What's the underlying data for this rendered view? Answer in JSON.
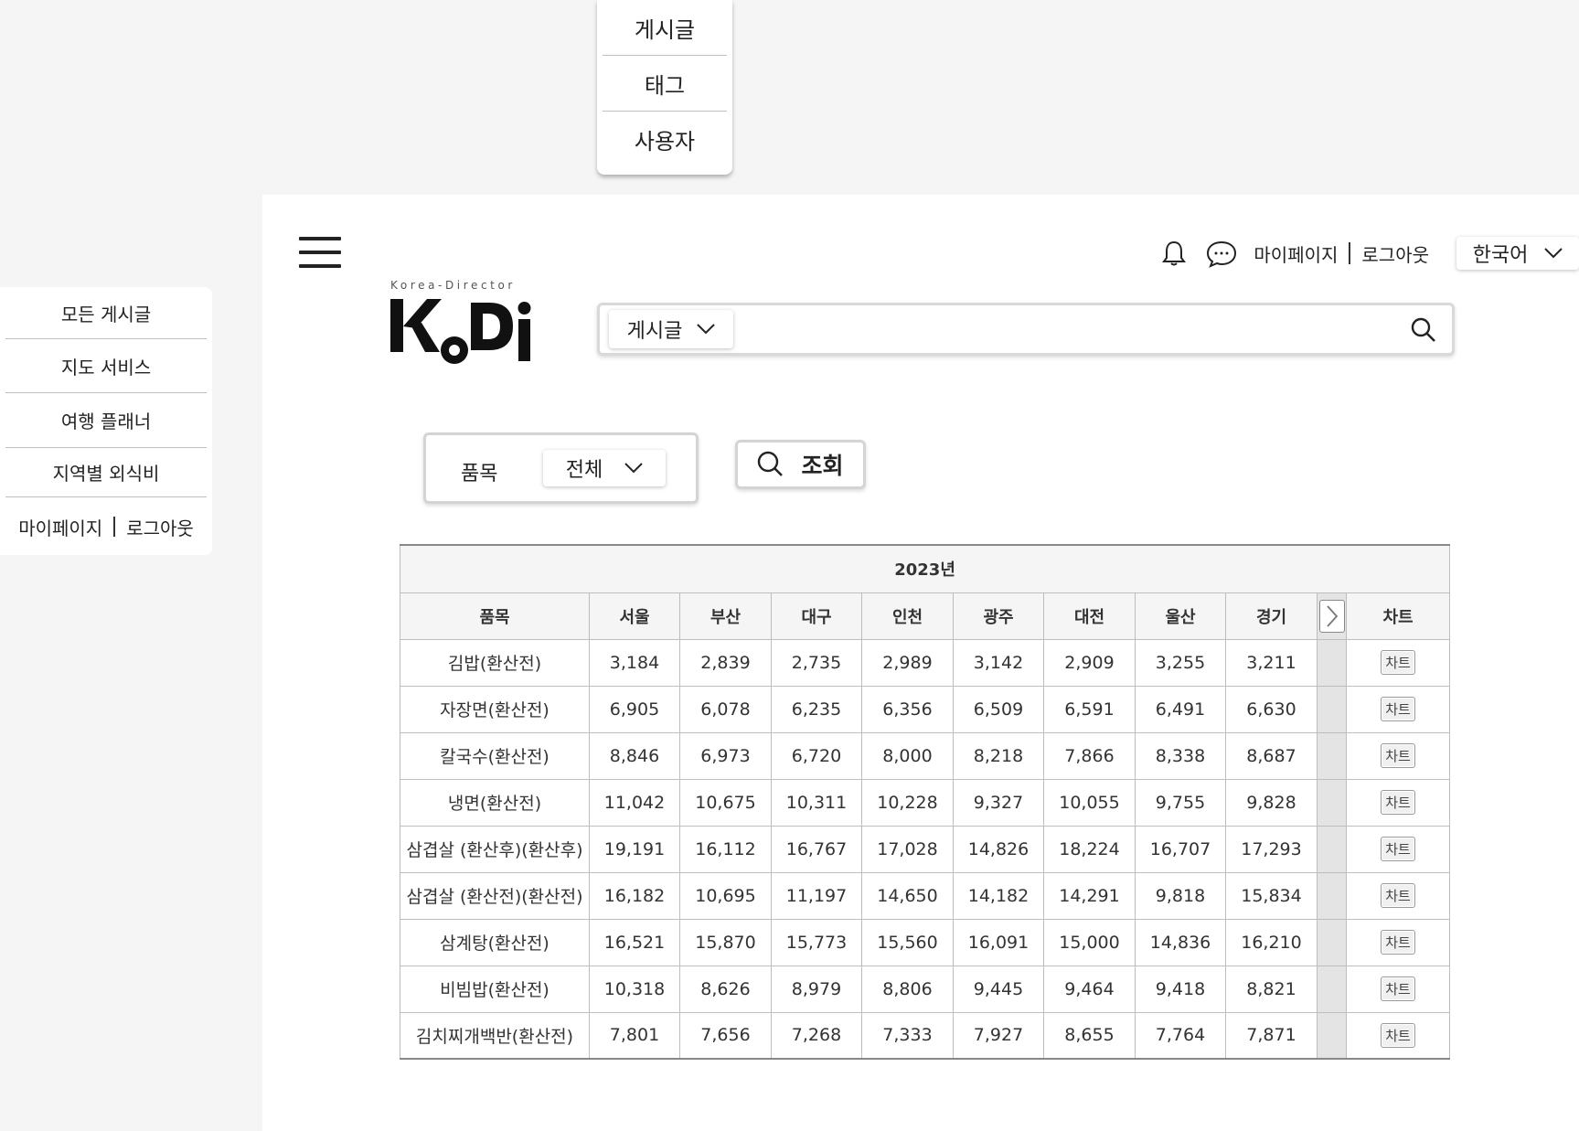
{
  "category_dropdown": {
    "options": [
      "게시글",
      "태그",
      "사용자"
    ]
  },
  "header": {
    "logo_tagline": "Korea-Director",
    "logo_text": "KoDi",
    "mypage_label": "마이페이지",
    "logout_label": "로그아웃",
    "language": "한국어",
    "icons": [
      "bell-icon",
      "chat-icon"
    ]
  },
  "search": {
    "type_label": "게시글",
    "value": "",
    "icon": "search-icon"
  },
  "filter": {
    "label": "품목",
    "selected": "전체",
    "query_button": "조회"
  },
  "table": {
    "year": "2023년",
    "columns": [
      "품목",
      "서울",
      "부산",
      "대구",
      "인천",
      "광주",
      "대전",
      "울산",
      "경기"
    ],
    "chart_column": "차트",
    "chart_button": "차트",
    "rows": [
      {
        "item": "김밥(환산전)",
        "values": [
          "3,184",
          "2,839",
          "2,735",
          "2,989",
          "3,142",
          "2,909",
          "3,255",
          "3,211"
        ]
      },
      {
        "item": "자장면(환산전)",
        "values": [
          "6,905",
          "6,078",
          "6,235",
          "6,356",
          "6,509",
          "6,591",
          "6,491",
          "6,630"
        ]
      },
      {
        "item": "칼국수(환산전)",
        "values": [
          "8,846",
          "6,973",
          "6,720",
          "8,000",
          "8,218",
          "7,866",
          "8,338",
          "8,687"
        ]
      },
      {
        "item": "냉면(환산전)",
        "values": [
          "11,042",
          "10,675",
          "10,311",
          "10,228",
          "9,327",
          "10,055",
          "9,755",
          "9,828"
        ]
      },
      {
        "item": "삼겹살 (환산후)(환산후)",
        "values": [
          "19,191",
          "16,112",
          "16,767",
          "17,028",
          "14,826",
          "18,224",
          "16,707",
          "17,293"
        ]
      },
      {
        "item": "삼겹살 (환산전)(환산전)",
        "values": [
          "16,182",
          "10,695",
          "11,197",
          "14,650",
          "14,182",
          "14,291",
          "9,818",
          "15,834"
        ]
      },
      {
        "item": "삼계탕(환산전)",
        "values": [
          "16,521",
          "15,870",
          "15,773",
          "15,560",
          "16,091",
          "15,000",
          "14,836",
          "16,210"
        ]
      },
      {
        "item": "비빔밥(환산전)",
        "values": [
          "10,318",
          "8,626",
          "8,979",
          "8,806",
          "9,445",
          "9,464",
          "9,418",
          "8,821"
        ]
      },
      {
        "item": "김치찌개백반(환산전)",
        "values": [
          "7,801",
          "7,656",
          "7,268",
          "7,333",
          "7,927",
          "8,655",
          "7,764",
          "7,871"
        ]
      }
    ]
  },
  "side_menu": {
    "items": [
      "모든 게시글",
      "지도 서비스",
      "여행 플래너",
      "지역별 외식비"
    ],
    "mypage_label": "마이페이지",
    "logout_label": "로그아웃"
  }
}
